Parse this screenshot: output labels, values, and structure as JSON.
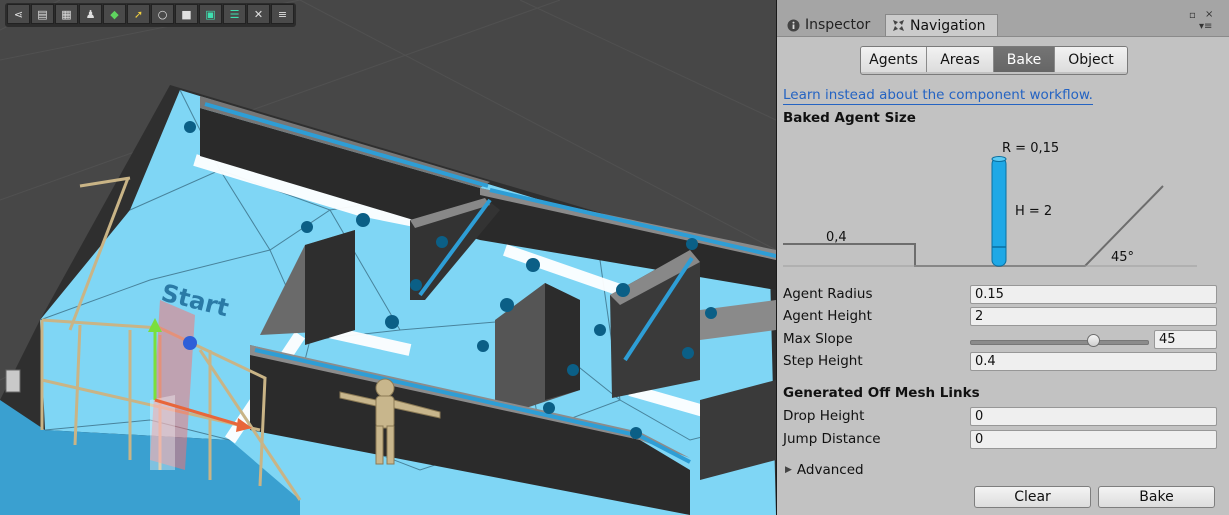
{
  "toolbar": {
    "buttons": [
      {
        "icon": "share-icon",
        "glyph": "⋖"
      },
      {
        "icon": "layers-icon",
        "glyph": "▤"
      },
      {
        "icon": "grid-icon",
        "glyph": "▦"
      },
      {
        "icon": "person-icon",
        "glyph": "♟"
      },
      {
        "icon": "gem-icon",
        "glyph": "◆"
      },
      {
        "icon": "arrow-icon",
        "glyph": "➚"
      },
      {
        "icon": "refresh-icon",
        "glyph": "○"
      },
      {
        "icon": "camera-icon",
        "glyph": "■"
      },
      {
        "icon": "navmesh-icon",
        "glyph": "▣"
      },
      {
        "icon": "list-icon",
        "glyph": "☰"
      },
      {
        "icon": "close-icon",
        "glyph": "✕"
      },
      {
        "icon": "menu-icon",
        "glyph": "≡"
      }
    ]
  },
  "scene": {
    "floor_label": "Start"
  },
  "tabs": {
    "inspector": "Inspector",
    "navigation": "Navigation"
  },
  "segments": [
    {
      "label": "Agents",
      "active": false
    },
    {
      "label": "Areas",
      "active": false
    },
    {
      "label": "Bake",
      "active": true
    },
    {
      "label": "Object",
      "active": false
    }
  ],
  "learn_link": "Learn instead about the component workflow.",
  "baked_agent_size": {
    "title": "Baked Agent Size",
    "radius_label": "R = 0,15",
    "height_label": "H = 2",
    "step_label": "0,4",
    "slope_label": "45°"
  },
  "properties": {
    "agent_radius": {
      "label": "Agent Radius",
      "value": "0.15"
    },
    "agent_height": {
      "label": "Agent Height",
      "value": "2"
    },
    "max_slope": {
      "label": "Max Slope",
      "value": "45",
      "slider_fraction": 0.7
    },
    "step_height": {
      "label": "Step Height",
      "value": "0.4"
    }
  },
  "off_mesh": {
    "title": "Generated Off Mesh Links",
    "drop_height": {
      "label": "Drop Height",
      "value": "0"
    },
    "jump_distance": {
      "label": "Jump Distance",
      "value": "0"
    }
  },
  "advanced_label": "Advanced",
  "buttons": {
    "clear": "Clear",
    "bake": "Bake"
  },
  "colors": {
    "navmesh": "#7fd6f5",
    "agent": "#1ea8e6",
    "link": "#2463c2"
  }
}
